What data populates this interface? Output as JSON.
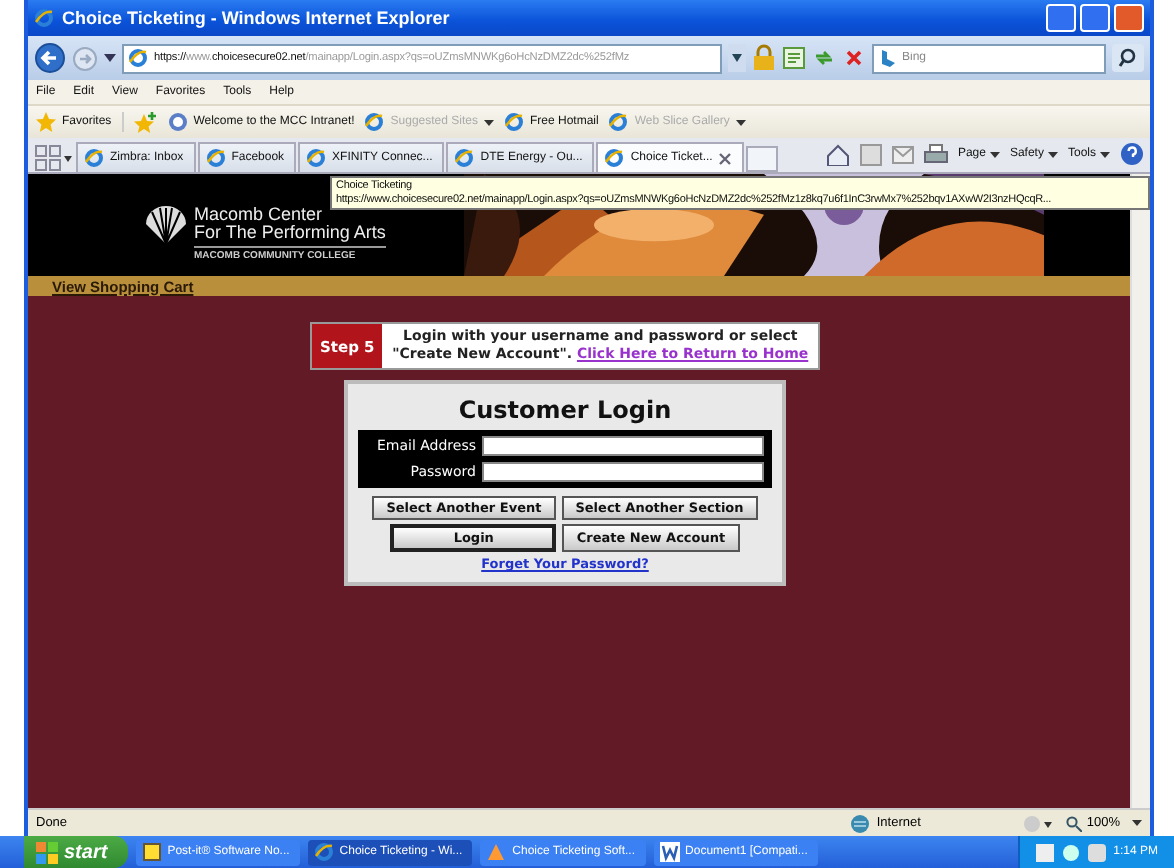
{
  "window": {
    "title": "Choice Ticketing - Windows Internet Explorer"
  },
  "address_bar": {
    "scheme": "https://",
    "host_prefix": "www.",
    "domain": "choicesecure02.net",
    "path": "/mainapp/Login.aspx?qs=oUZmsMNWKg6oHcNzDMZ2dc%252fMz"
  },
  "search": {
    "placeholder": "Bing"
  },
  "menu": [
    "File",
    "Edit",
    "View",
    "Favorites",
    "Tools",
    "Help"
  ],
  "favorites_bar": {
    "label": "Favorites",
    "items": [
      {
        "label": "Welcome to the MCC Intranet!",
        "disabled": false,
        "dropdown": false
      },
      {
        "label": "Suggested Sites",
        "disabled": true,
        "dropdown": true
      },
      {
        "label": "Free Hotmail",
        "disabled": false,
        "dropdown": false
      },
      {
        "label": "Web Slice Gallery",
        "disabled": true,
        "dropdown": true
      }
    ]
  },
  "tabs": [
    {
      "label": "Zimbra: Inbox",
      "selected": false
    },
    {
      "label": "Facebook",
      "selected": false
    },
    {
      "label": "XFINITY Connec...",
      "selected": false
    },
    {
      "label": "DTE Energy - Ou...",
      "selected": false
    },
    {
      "label": "Choice Ticket...",
      "selected": true
    }
  ],
  "command_bar": [
    "Page",
    "Safety",
    "Tools"
  ],
  "tooltip": {
    "title": "Choice Ticketing",
    "url": "https://www.choicesecure02.net/mainapp/Login.aspx?qs=oUZmsMNWKg6oHcNzDMZ2dc%252fMz1z8kq7u6f1InC3rwMx7%252bqv1AXwW2I3nzHQcqR..."
  },
  "banner": {
    "logo_lines": [
      "Macomb Center",
      "For The Performing Arts"
    ],
    "college": "MACOMB COMMUNITY COLLEGE"
  },
  "nav_link": "View Shopping Cart",
  "step": {
    "label": "Step 5",
    "message": "Login with your username and password or select \"Create New Account\".",
    "link": "Click Here to Return to Home"
  },
  "login": {
    "title": "Customer Login",
    "fields": [
      {
        "label": "Email Address"
      },
      {
        "label": "Password"
      }
    ],
    "buttons": [
      [
        "Select Another Event",
        "Select Another Section"
      ],
      [
        "Login",
        "Create New Account"
      ]
    ],
    "link": "Forget Your Password?"
  },
  "status_bar": {
    "text": "Done",
    "zone": "Internet",
    "zoom": "100%"
  },
  "taskbar": {
    "start": "start",
    "items": [
      {
        "label": "Post-it® Software No...",
        "selected": false
      },
      {
        "label": "Choice Ticketing - Wi...",
        "selected": true
      },
      {
        "label": "Choice Ticketing Soft...",
        "selected": false
      },
      {
        "label": "Document1 [Compati...",
        "selected": false
      }
    ],
    "clock": "1:14 PM"
  }
}
